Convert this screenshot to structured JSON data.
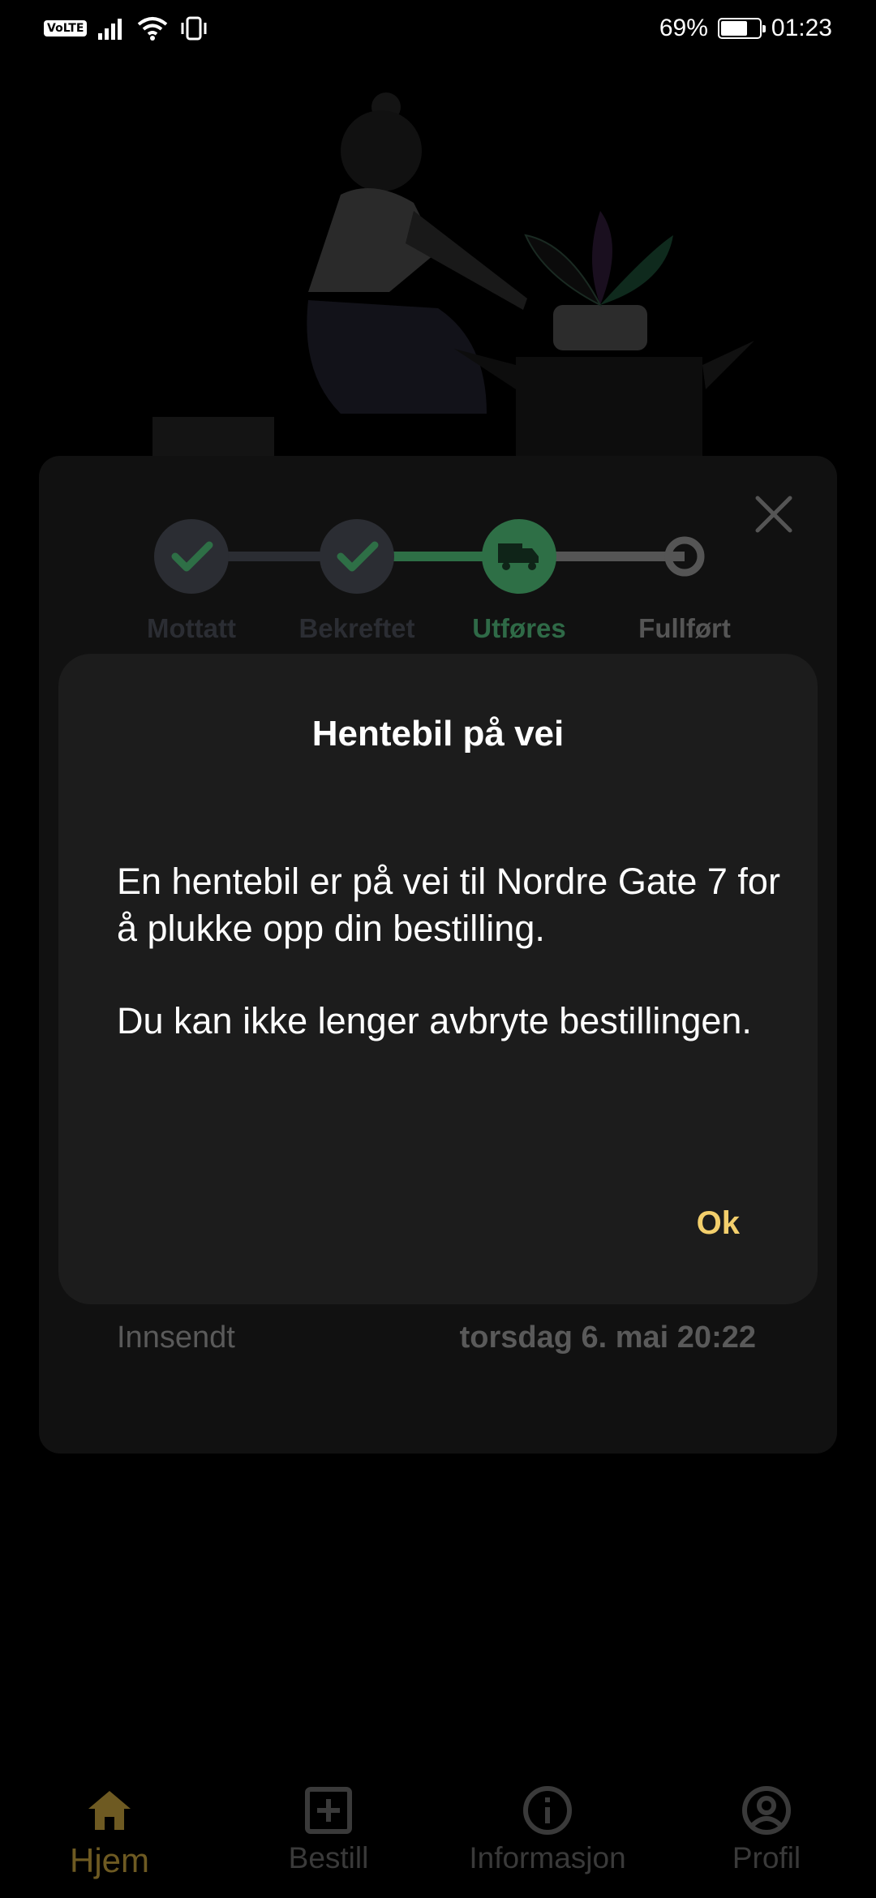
{
  "status_bar": {
    "left_icons": [
      "volte-icon",
      "signal-icon",
      "wifi-icon",
      "vibrate-icon"
    ],
    "volte_text": "VoLTE",
    "battery": "69%",
    "battery_level": 0.69,
    "time": "01:23"
  },
  "stepper": {
    "steps": [
      {
        "label": "Mottatt",
        "state": "done"
      },
      {
        "label": "Bekreftet",
        "state": "done"
      },
      {
        "label": "Utføres",
        "state": "active"
      },
      {
        "label": "Fullført",
        "state": "pending"
      }
    ],
    "colors": {
      "done": "#2b2d33",
      "active": "#2e6f46",
      "pending": "#555555",
      "active_label": "#2f6a47"
    }
  },
  "card": {
    "submitted_label": "Innsendt",
    "submitted_value": "torsdag 6. mai 20:22"
  },
  "dialog": {
    "title": "Hentebil på vei",
    "paragraph_1": "En hentebil er på vei til Nordre Gate 7 for å plukke opp din bestilling.",
    "paragraph_2": "Du kan ikke lenger avbryte bestillingen.",
    "ok_label": "Ok",
    "accent_color": "#f3cf6c"
  },
  "bottom_nav": {
    "items": [
      {
        "label": "Hjem",
        "icon": "home-icon",
        "active": true
      },
      {
        "label": "Bestill",
        "icon": "plus-square-icon",
        "active": false
      },
      {
        "label": "Informasjon",
        "icon": "info-icon",
        "active": false
      },
      {
        "label": "Profil",
        "icon": "profile-icon",
        "active": false
      }
    ]
  }
}
